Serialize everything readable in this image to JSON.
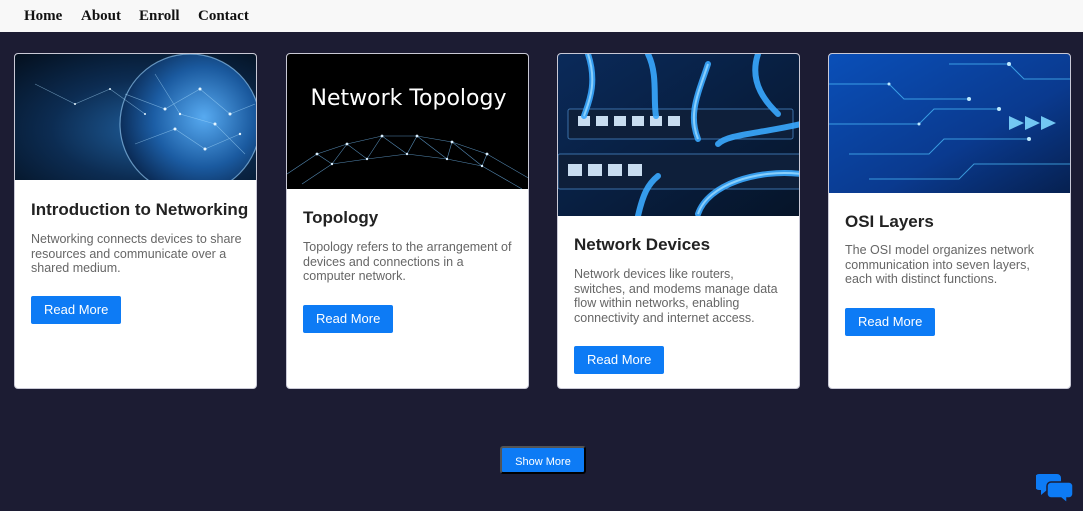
{
  "nav": {
    "items": [
      "Home",
      "About",
      "Enroll",
      "Contact"
    ]
  },
  "cards": [
    {
      "title": "Introduction to Networking",
      "text": "Networking connects devices to share resources and communicate over a shared medium.",
      "button": "Read More",
      "image": "globe-network-image"
    },
    {
      "title": "Topology",
      "text": "Topology refers to the arrangement of devices and connections in a computer network.",
      "button": "Read More",
      "image": "network-topology-image",
      "image_caption": "Network Topology"
    },
    {
      "title": "Network Devices",
      "text": "Network devices like routers, switches, and modems manage data flow within networks, enabling connectivity and internet access.",
      "button": "Read More",
      "image": "network-switch-cables-image"
    },
    {
      "title": "OSI Layers",
      "text": "The OSI model organizes network communication into seven layers, each with distinct functions.",
      "button": "Read More",
      "image": "circuit-arrow-image"
    }
  ],
  "show_more": "Show More",
  "chat_icon": "chat-bubbles-icon",
  "colors": {
    "background": "#1c1c33",
    "navbar": "#f8f8f8",
    "accent": "#0d7bf5"
  }
}
